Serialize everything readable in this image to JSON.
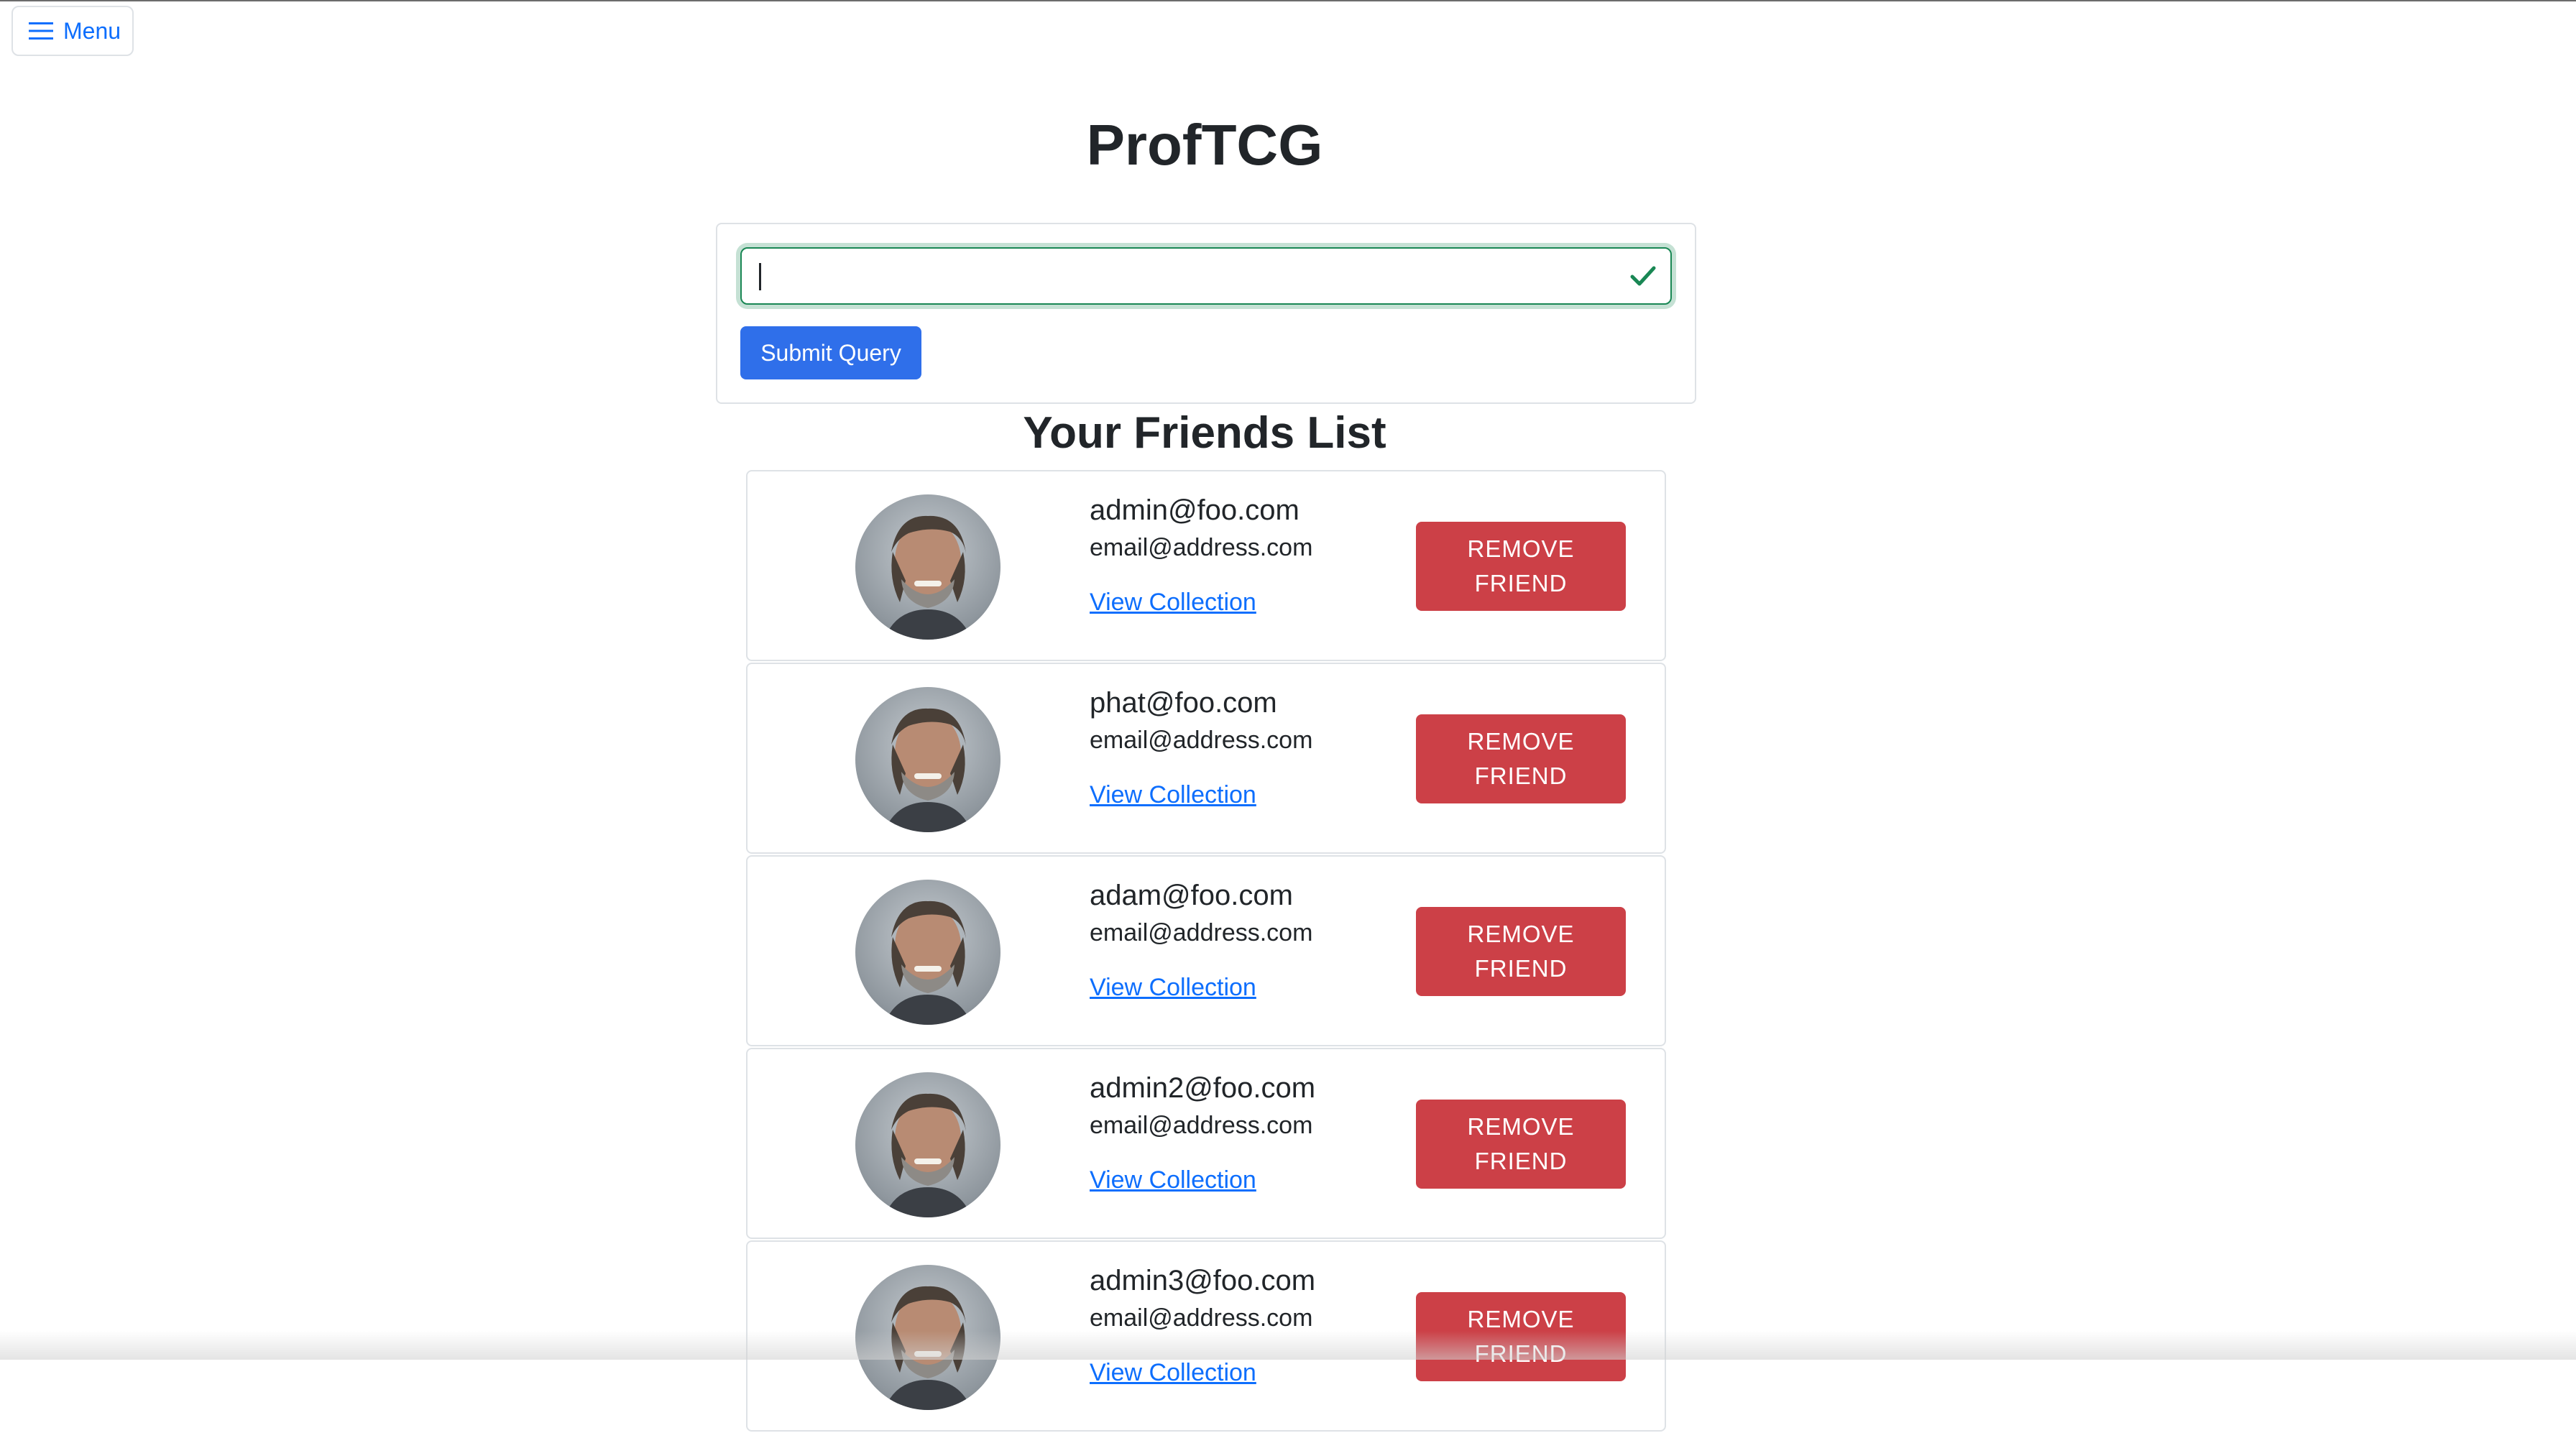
{
  "menu": {
    "label": "Menu",
    "icon": "hamburger-icon"
  },
  "title": "ProfTCG",
  "search": {
    "value": "",
    "placeholder": "",
    "submit_label": "Submit Query",
    "valid_icon": "check-icon"
  },
  "friends_heading": "Your Friends List",
  "friends": [
    {
      "name": "admin@foo.com",
      "email": "email@address.com",
      "link_label": "View Collection",
      "remove_label": "REMOVE FRIEND"
    },
    {
      "name": "phat@foo.com",
      "email": "email@address.com",
      "link_label": "View Collection",
      "remove_label": "REMOVE FRIEND"
    },
    {
      "name": "adam@foo.com",
      "email": "email@address.com",
      "link_label": "View Collection",
      "remove_label": "REMOVE FRIEND"
    },
    {
      "name": "admin2@foo.com",
      "email": "email@address.com",
      "link_label": "View Collection",
      "remove_label": "REMOVE FRIEND"
    },
    {
      "name": "admin3@foo.com",
      "email": "email@address.com",
      "link_label": "View Collection",
      "remove_label": "REMOVE FRIEND"
    }
  ],
  "colors": {
    "primary": "#2f6fea",
    "link": "#0d6efd",
    "danger": "#cc4047",
    "valid": "#198754"
  }
}
